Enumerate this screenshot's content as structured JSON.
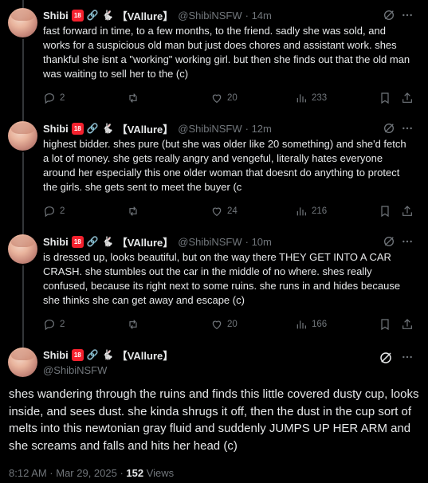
{
  "author": {
    "name": "Shibi",
    "badge18": "18",
    "emoji_link": "🔗",
    "emoji_rabbit": "🐇",
    "brand": "【VAllure】",
    "handle": "@ShibiNSFW"
  },
  "tweets": [
    {
      "time": "· 14m",
      "text": "fast forward in time, to a few months, to the friend. sadly she was sold, and works for a suspicious old man but just does chores and assistant work. shes thankful she isnt a \"working\" working girl. but then she finds out that the old man was waiting to sell her to the (c)",
      "replies": "2",
      "likes": "20",
      "views": "233"
    },
    {
      "time": "· 12m",
      "text": "highest bidder. shes pure (but she was older like 20 something) and she'd fetch a lot of money. she gets really angry and vengeful, literally hates everyone around her especially this one older woman that doesnt do anything to protect the girls. she gets sent to meet the buyer (c",
      "replies": "2",
      "likes": "24",
      "views": "216"
    },
    {
      "time": "· 10m",
      "text": "is dressed up, looks beautiful, but on the way there THEY GET INTO A CAR CRASH. she stumbles out the car in the middle of no where. shes really confused, because its right next to some ruins. she runs in and hides because she thinks she can get away and escape (c)",
      "replies": "2",
      "likes": "20",
      "views": "166"
    }
  ],
  "main": {
    "text": "shes wandering through the ruins and finds this little covered dusty cup, looks inside, and sees dust. she kinda shrugs it off, then the dust in the cup sort of melts into this newtonian gray fluid and suddenly JUMPS UP HER ARM and she screams and falls and hits her head (c)",
    "timestamp": "8:12 AM · Mar 29, 2025 · ",
    "views_count": "152",
    "views_label": " Views"
  },
  "colors": {
    "bg": "#000000",
    "text": "#e7e9ea",
    "muted": "#71767b",
    "line": "#333639"
  }
}
